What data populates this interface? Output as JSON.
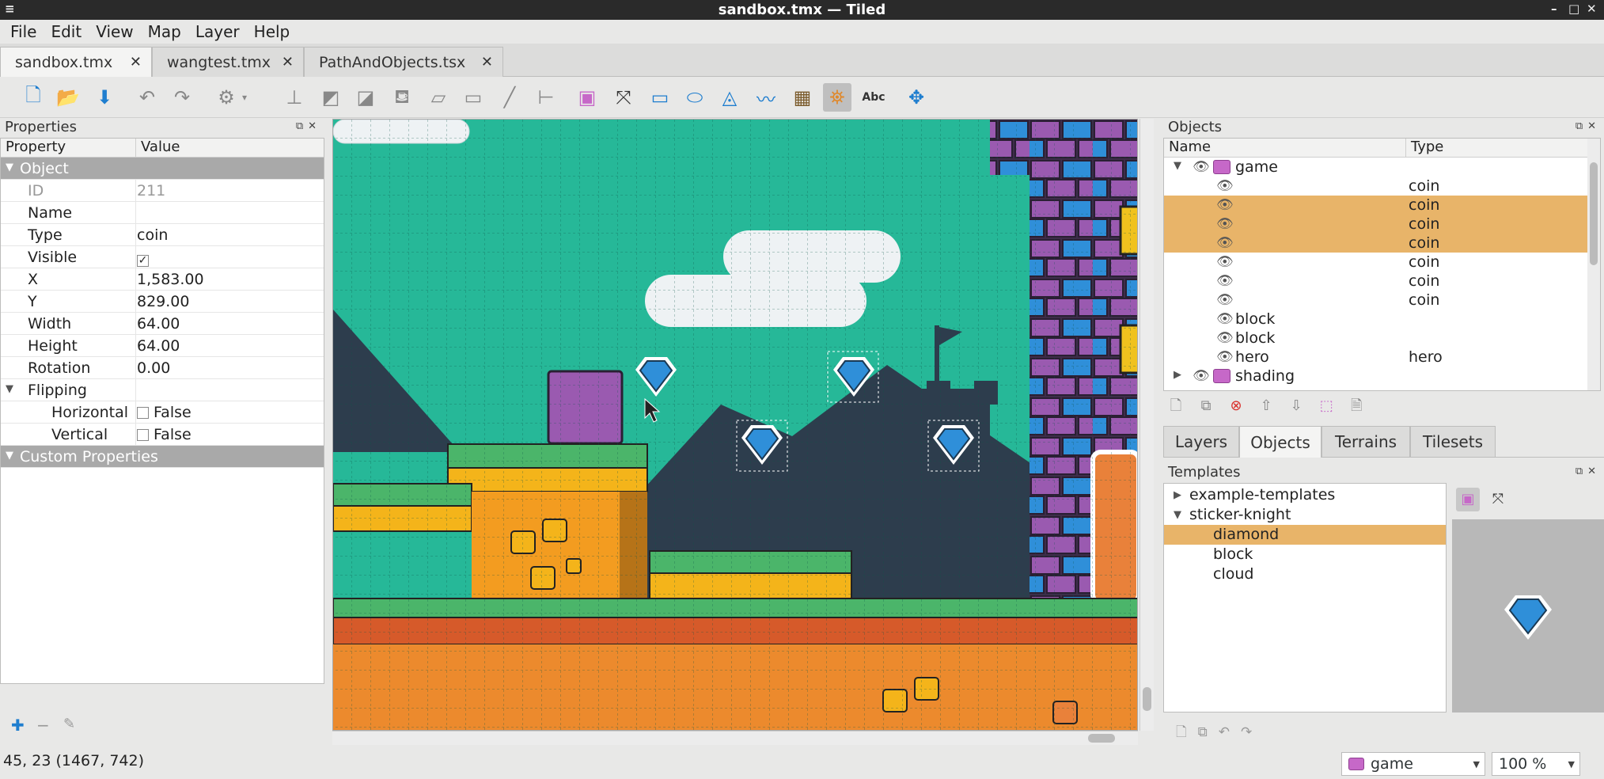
{
  "window": {
    "title": "sandbox.tmx — Tiled"
  },
  "menu": [
    "File",
    "Edit",
    "View",
    "Map",
    "Layer",
    "Help"
  ],
  "tabs": [
    {
      "label": "sandbox.tmx",
      "active": true
    },
    {
      "label": "wangtest.tmx",
      "active": false
    },
    {
      "label": "PathAndObjects.tsx",
      "active": false
    }
  ],
  "properties": {
    "title": "Properties",
    "col_property": "Property",
    "col_value": "Value",
    "group_object": "Object",
    "rows": [
      {
        "key": "ID",
        "value": "211"
      },
      {
        "key": "Name",
        "value": ""
      },
      {
        "key": "Type",
        "value": "coin"
      },
      {
        "key": "Visible",
        "value": "✓"
      },
      {
        "key": "X",
        "value": "1,583.00"
      },
      {
        "key": "Y",
        "value": "829.00"
      },
      {
        "key": "Width",
        "value": "64.00"
      },
      {
        "key": "Height",
        "value": "64.00"
      },
      {
        "key": "Rotation",
        "value": "0.00"
      }
    ],
    "flipping": {
      "label": "Flipping",
      "horizontal_label": "Horizontal",
      "horizontal_value": "False",
      "vertical_label": "Vertical",
      "vertical_value": "False"
    },
    "group_custom": "Custom Properties"
  },
  "status": {
    "coords": "45, 23 (1467, 742)"
  },
  "objects_panel": {
    "title": "Objects",
    "col_name": "Name",
    "col_type": "Type",
    "layer_game": "game",
    "layer_shading": "shading",
    "items": [
      {
        "name": "",
        "type": "coin",
        "selected": false
      },
      {
        "name": "",
        "type": "coin",
        "selected": true
      },
      {
        "name": "",
        "type": "coin",
        "selected": true
      },
      {
        "name": "",
        "type": "coin",
        "selected": true
      },
      {
        "name": "",
        "type": "coin",
        "selected": false
      },
      {
        "name": "",
        "type": "coin",
        "selected": false
      },
      {
        "name": "",
        "type": "coin",
        "selected": false
      },
      {
        "name": "block",
        "type": "",
        "selected": false
      },
      {
        "name": "block",
        "type": "",
        "selected": false
      },
      {
        "name": "hero",
        "type": "hero",
        "selected": false
      }
    ]
  },
  "right_tabs": [
    {
      "label": "Layers",
      "active": false
    },
    {
      "label": "Objects",
      "active": true
    },
    {
      "label": "Terrains",
      "active": false
    },
    {
      "label": "Tilesets",
      "active": false
    }
  ],
  "templates": {
    "title": "Templates",
    "folders": [
      {
        "label": "example-templates",
        "expanded": false
      },
      {
        "label": "sticker-knight",
        "expanded": true
      }
    ],
    "items": [
      {
        "label": "diamond",
        "selected": true
      },
      {
        "label": "block",
        "selected": false
      },
      {
        "label": "cloud",
        "selected": false
      }
    ]
  },
  "layer_combo": {
    "value": "game"
  },
  "zoom_combo": {
    "value": "100 %"
  },
  "colors": {
    "accent": "#1f7ecf",
    "selection": "#e8b469",
    "canvas_bg": "#26b898",
    "layer_icon": "#c668c8"
  }
}
